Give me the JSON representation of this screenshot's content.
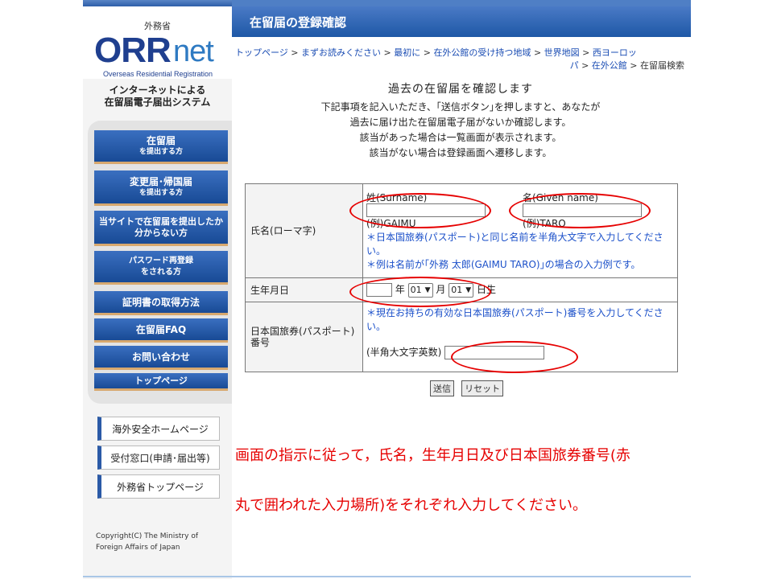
{
  "sidebar": {
    "ministry_small": "外務省",
    "logo_orr": "ORR",
    "logo_net": "net",
    "logo_sub": "Overseas Residential Registration",
    "system_name_1": "インターネットによる",
    "system_name_2": "在留届電子届出システム",
    "nav": [
      {
        "l1": "在留届",
        "l2": "を提出する方"
      },
      {
        "l1": "変更届･帰国届",
        "l2": "を提出する方"
      },
      {
        "l1": "当サイトで在留届を提出したか",
        "l2": "分からない方"
      },
      {
        "l1": "パスワード再登録",
        "l2": "をされる方"
      },
      {
        "label": "証明書の取得方法"
      },
      {
        "label": "在留届FAQ"
      },
      {
        "label": "お問い合わせ"
      },
      {
        "label": "トップページ"
      }
    ],
    "sub": [
      "海外安全ホームページ",
      "受付窓口(申請･届出等)",
      "外務省トップページ"
    ],
    "copyright_1": "Copyright(C)  The Ministry of",
    "copyright_2": "Foreign Affairs of Japan"
  },
  "header": {
    "title": "在留届の登録確認"
  },
  "breadcrumb": {
    "items": [
      "トップページ",
      "まずお読みください",
      "最初に",
      "在外公館の受け持つ地域",
      "世界地図",
      "西ヨーロッ",
      "パ",
      "在外公館"
    ],
    "sep": ">",
    "current": "在留届検索"
  },
  "intro": {
    "title": "過去の在留届を確認します",
    "lines": [
      "下記事項を記入いただき、｢送信ボタン｣を押しますと、あなたが",
      "過去に届け出た在留届電子届がないか確認します。",
      "該当があった場合は一覧画面が表示されます。",
      "該当がない場合は登録画面へ遷移します。"
    ]
  },
  "form": {
    "name_label": "氏名(ローマ字)",
    "surname_label": "姓(Surname)",
    "given_label": "名(Given name)",
    "surname_example": "(例)GAIMU",
    "given_example": "(例)TARO",
    "name_note1": "＊日本国旅券(パスポート)と同じ名前を半角大文字で入力してください。",
    "name_note2": "＊例は名前が｢外務 太郎(GAIMU TARO)｣の場合の入力例です。",
    "dob_label": "生年月日",
    "year_unit": "年",
    "month_value": "01",
    "month_unit": "月",
    "day_value": "01",
    "day_unit": "日生",
    "passport_label": "日本国旅券(パスポート)番号",
    "passport_note": "＊現在お持ちの有効な日本国旅券(パスポート)番号を入力してください。",
    "passport_hint": "(半角大文字英数)"
  },
  "buttons": {
    "submit": "送信",
    "reset": "リセット"
  },
  "annotation": {
    "line1": "画面の指示に従って，氏名，生年月日及び日本国旅券番号(赤",
    "line2": "丸で囲われた入力場所)をそれぞれ入力してください。"
  },
  "colors": {
    "brand": "#1f4f9e",
    "annotation": "#e60000",
    "note": "#1a4fc9"
  }
}
